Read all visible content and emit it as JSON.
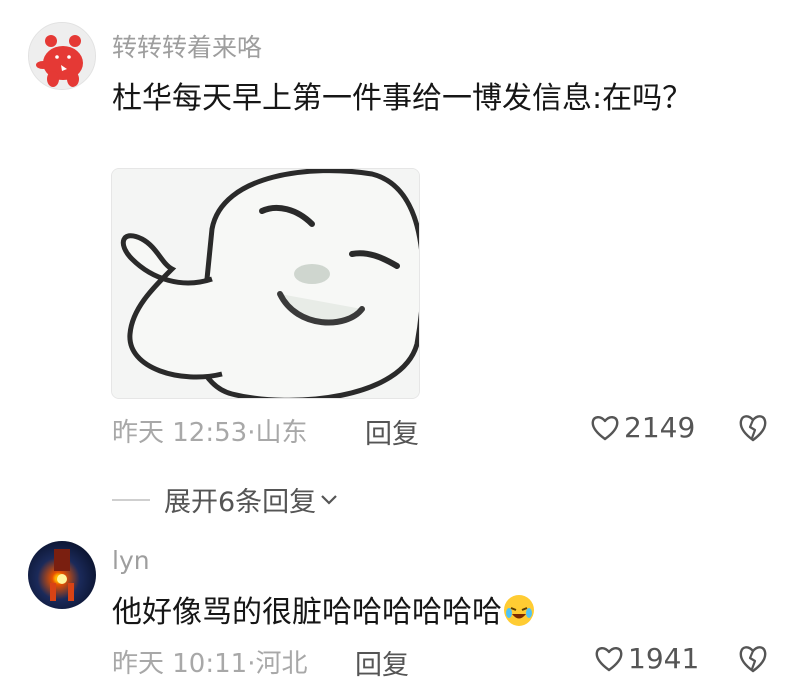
{
  "comments": [
    {
      "username": "转转转着来咯",
      "text": "杜华每天早上第一件事给一博发信息:在吗？",
      "time": "昨天 12:53·山东",
      "reply_label": "回复",
      "likes": "2149",
      "has_sticker": true,
      "expand_label": "展开6条回复"
    },
    {
      "username": "lyn",
      "text": "他好像骂的很脏哈哈哈哈哈哈",
      "emoji": "laughing-tears-emoji",
      "time": "昨天 10:11·河北",
      "reply_label": "回复",
      "likes": "1941"
    }
  ],
  "colors": {
    "username": "#9e9e9e",
    "text": "#161616",
    "meta": "#a8a8a8",
    "action": "#555555"
  }
}
